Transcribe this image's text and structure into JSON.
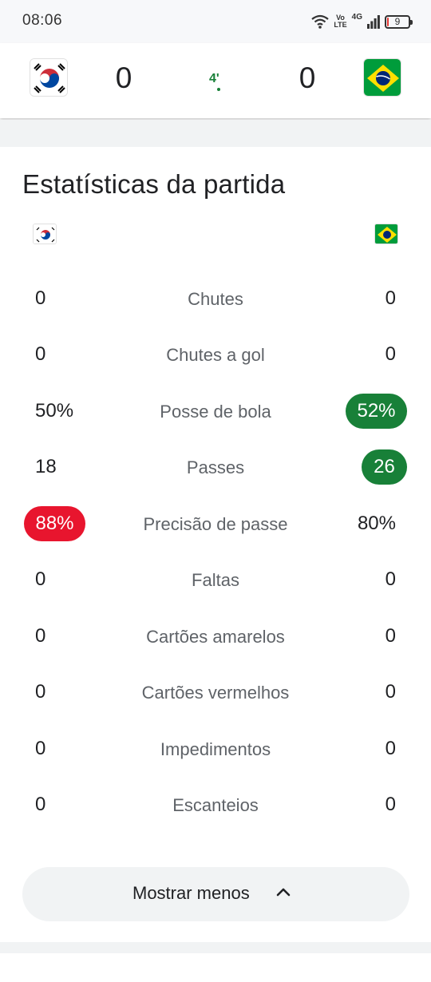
{
  "status_bar": {
    "time": "08:06",
    "volte_line1": "Vo",
    "volte_line2": "LTE",
    "network": "4G",
    "battery": "9",
    "battery_level": 0.09
  },
  "match": {
    "home_score": "0",
    "away_score": "0",
    "clock": "4'",
    "home_flag": "south-korea-flag",
    "away_flag": "brazil-flag"
  },
  "stats": {
    "title": "Estatísticas da partida",
    "rows": [
      {
        "label": "Chutes",
        "home": "0",
        "away": "0"
      },
      {
        "label": "Chutes a gol",
        "home": "0",
        "away": "0"
      },
      {
        "label": "Posse de bola",
        "home": "50%",
        "away": "52%"
      },
      {
        "label": "Passes",
        "home": "18",
        "away": "26"
      },
      {
        "label": "Precisão de passe",
        "home": "88%",
        "away": "80%"
      },
      {
        "label": "Faltas",
        "home": "0",
        "away": "0"
      },
      {
        "label": "Cartões amarelos",
        "home": "0",
        "away": "0"
      },
      {
        "label": "Cartões vermelhos",
        "home": "0",
        "away": "0"
      },
      {
        "label": "Impedimentos",
        "home": "0",
        "away": "0"
      },
      {
        "label": "Escanteios",
        "home": "0",
        "away": "0"
      }
    ],
    "highlight_green": "#188038",
    "highlight_red": "#e8152e"
  },
  "actions": {
    "show_less_label": "Mostrar menos"
  }
}
